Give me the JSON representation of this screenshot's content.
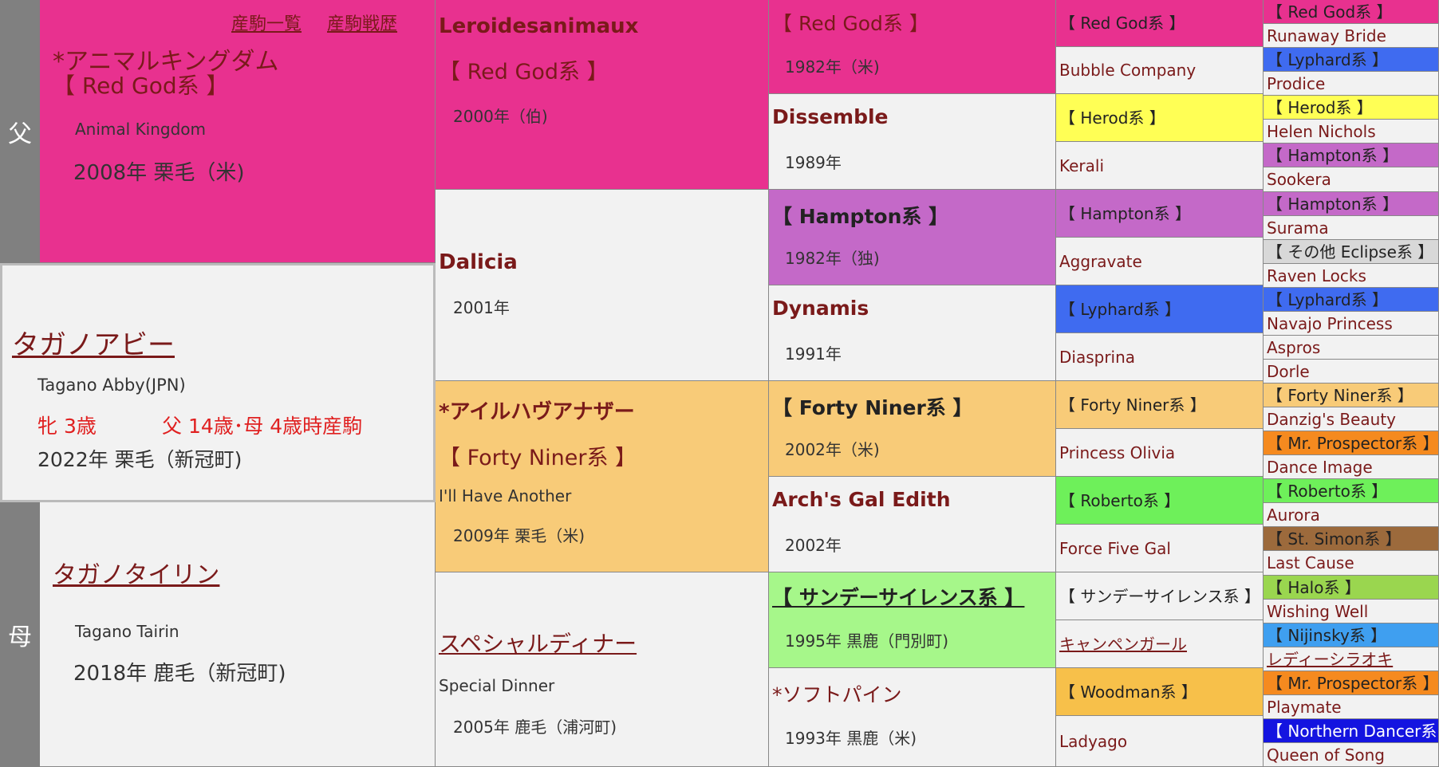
{
  "labels": {
    "sire": "父",
    "dam": "母"
  },
  "links": {
    "offspring": "産駒一覧",
    "offspring_record": "産駒戦歴"
  },
  "horse": {
    "name": "タガノアビー",
    "name_en": "Tagano Abby(JPN)",
    "sex_age": "牝  3歳",
    "parent_ages": "父 14歳･母 4歳時産駒",
    "birth": "2022年  栗毛（新冠町)"
  },
  "sire": {
    "name": "*アニマルキングダム",
    "line": "【 Red God系 】",
    "name_en": "Animal Kingdom",
    "birth": "2008年  栗毛（米)"
  },
  "dam": {
    "name": "タガノタイリン",
    "name_en": "Tagano Tairin",
    "birth": "2018年  鹿毛（新冠町)"
  },
  "g2": [
    {
      "name": "Leroidesanimaux",
      "line": "【 Red God系 】",
      "year": "2000年（伯)"
    },
    {
      "name": "Dalicia",
      "year": "2001年"
    },
    {
      "name": "*アイルハヴアナザー",
      "line": "【 Forty Niner系 】",
      "en": "I'll Have Another",
      "year": "2009年  栗毛（米)"
    },
    {
      "name": "スペシャルディナー",
      "en": "Special Dinner",
      "year": "2005年  鹿毛（浦河町)"
    }
  ],
  "g3": [
    {
      "name": "【 Red God系 】",
      "year": "1982年（米)"
    },
    {
      "name": "Dissemble",
      "year": "1989年"
    },
    {
      "name": "【 Hampton系 】",
      "year": "1982年（独)"
    },
    {
      "name": "Dynamis",
      "year": "1991年"
    },
    {
      "name": "【 Forty Niner系 】",
      "year": "2002年（米)"
    },
    {
      "name": "Arch's Gal Edith",
      "year": "2002年"
    },
    {
      "name": "【 サンデーサイレンス系 】",
      "year": "1995年  黒鹿（門別町)"
    },
    {
      "name": "*ソフトパイン",
      "year": "1993年  黒鹿（米)"
    }
  ],
  "g4": [
    "【 Red God系 】",
    "Bubble Company",
    "【 Herod系 】",
    "Kerali",
    "【 Hampton系 】",
    "Aggravate",
    "【 Lyphard系 】",
    "Diasprina",
    "【 Forty Niner系 】",
    "Princess Olivia",
    "【 Roberto系 】",
    "Force Five Gal",
    "【 サンデーサイレンス系 】",
    "キャンペンガール",
    "【 Woodman系 】",
    "Ladyago"
  ],
  "g5": [
    "【 Red God系 】",
    "Runaway Bride",
    "【 Lyphard系 】",
    "Prodice",
    "【 Herod系 】",
    "Helen Nichols",
    "【 Hampton系 】",
    "Sookera",
    "【 Hampton系 】",
    "Surama",
    "【 その他 Eclipse系 】",
    "Raven Locks",
    "【 Lyphard系 】",
    "Navajo Princess",
    "Aspros",
    "Dorle",
    "【 Forty Niner系 】",
    "Danzig's Beauty",
    "【 Mr. Prospector系 】",
    "Dance Image",
    "【 Roberto系 】",
    "Aurora",
    "【 St. Simon系 】",
    "Last Cause",
    "【 Halo系 】",
    "Wishing Well",
    "【 Nijinsky系 】",
    "レディーシラオキ",
    "【 Mr. Prospector系 】",
    "Playmate",
    "【 Northern Dancer系 】",
    "Queen of Song"
  ],
  "colors": {
    "redgod": "#e8318f",
    "herod": "#ffff55",
    "hampton": "#c469c8",
    "lyphard": "#3f6bf0",
    "forty": "#f8cb78",
    "roberto": "#6ef05a",
    "sunday": "#a6f78a",
    "woodman": "#f7c04a",
    "halo": "#9ad64f",
    "nijinsky": "#3f9ff0",
    "mrp": "#f58a1f",
    "stsimon": "#9c6a3c",
    "nd": "#1414e0",
    "eclipse": "#d8d8d8",
    "plain": "#f2f2f2"
  }
}
